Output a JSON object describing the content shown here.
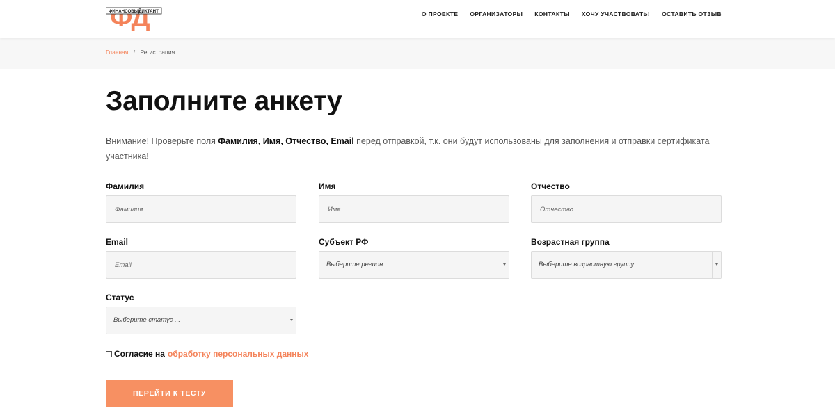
{
  "header": {
    "logo_text": "ФД",
    "logo_banner_left": "ФИНАНСОВЫЙ",
    "logo_banner_right": "ДИКТАНТ",
    "nav": [
      "О ПРОЕКТЕ",
      "ОРГАНИЗАТОРЫ",
      "КОНТАКТЫ",
      "ХОЧУ УЧАСТВОВАТЬ!",
      "ОСТАВИТЬ ОТЗЫВ"
    ]
  },
  "breadcrumb": {
    "home": "Главная",
    "separator": "/",
    "current": "Регистрация"
  },
  "page": {
    "title": "Заполните анкету",
    "notice_before": "Внимание! Проверьте поля ",
    "notice_bold": "Фамилия, Имя, Отчество, Email",
    "notice_after": " перед отправкой, т.к. они будут использованы для заполнения и отправки сертификата участника!"
  },
  "form": {
    "surname": {
      "label": "Фамилия",
      "placeholder": "Фамилия"
    },
    "name": {
      "label": "Имя",
      "placeholder": "Имя"
    },
    "patronymic": {
      "label": "Отчество",
      "placeholder": "Отчество"
    },
    "email": {
      "label": "Email",
      "placeholder": "Email"
    },
    "region": {
      "label": "Субъект РФ",
      "value": "Выберите регион ..."
    },
    "age_group": {
      "label": "Возрастная группа",
      "value": "Выберите возрастную группу ..."
    },
    "status": {
      "label": "Статус",
      "value": "Выберите статус ..."
    },
    "consent_text": "Согласие на",
    "consent_link": "обработку персональных данных",
    "submit_label": "ПЕРЕЙТИ К ТЕСТУ"
  },
  "colors": {
    "accent": "#f4835a",
    "button": "#f79062"
  }
}
